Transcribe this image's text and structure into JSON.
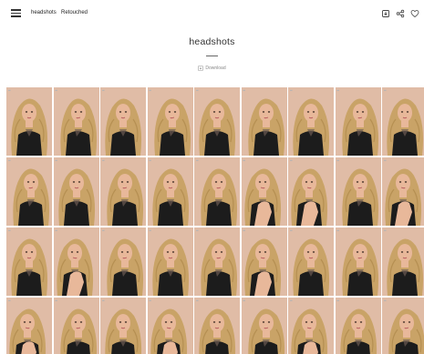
{
  "topbar": {
    "links": [
      "headshots",
      "Retouched"
    ],
    "icons": [
      "menu-icon",
      "download-icon",
      "share-icon",
      "heart-icon"
    ]
  },
  "header": {
    "title": "headshots",
    "download_label": "Download"
  },
  "gallery": {
    "columns": 9,
    "rows_visible": 4,
    "photos": [
      {
        "pose": "a"
      },
      {
        "pose": "b"
      },
      {
        "pose": "a"
      },
      {
        "pose": "b"
      },
      {
        "pose": "a"
      },
      {
        "pose": "b"
      },
      {
        "pose": "a"
      },
      {
        "pose": "b"
      },
      {
        "pose": "a"
      },
      {
        "pose": "b"
      },
      {
        "pose": "a"
      },
      {
        "pose": "b"
      },
      {
        "pose": "a"
      },
      {
        "pose": "b"
      },
      {
        "pose": "c"
      },
      {
        "pose": "c"
      },
      {
        "pose": "b"
      },
      {
        "pose": "c"
      },
      {
        "pose": "a"
      },
      {
        "pose": "c"
      },
      {
        "pose": "b"
      },
      {
        "pose": "a"
      },
      {
        "pose": "b"
      },
      {
        "pose": "c"
      },
      {
        "pose": "a"
      },
      {
        "pose": "b"
      },
      {
        "pose": "a"
      },
      {
        "pose": "c"
      },
      {
        "pose": "b"
      },
      {
        "pose": "a"
      },
      {
        "pose": "c"
      },
      {
        "pose": "a"
      },
      {
        "pose": "b"
      },
      {
        "pose": "c"
      },
      {
        "pose": "a"
      },
      {
        "pose": "b"
      }
    ]
  },
  "colors": {
    "background": "#ffffff",
    "photo_backdrop": "#e0bca6",
    "hair": "#c9a367",
    "skin": "#e8b89a",
    "dress": "#1c1c1c"
  }
}
